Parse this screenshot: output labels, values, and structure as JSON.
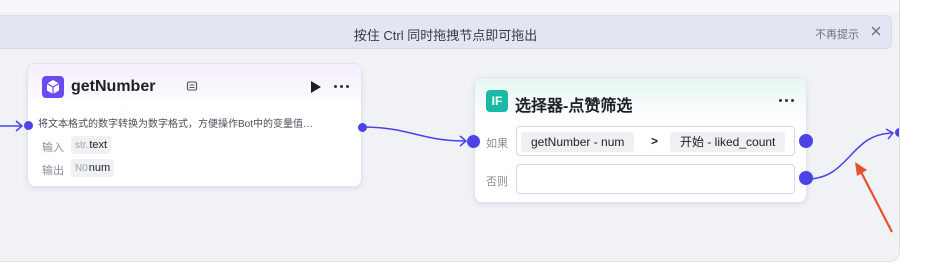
{
  "hint_bar": {
    "text": "按住 Ctrl 同时拖拽节点即可拖出",
    "dismiss_label": "不再提示"
  },
  "node_get_number": {
    "title": "getNumber",
    "description": "将文本格式的数字转换为数字格式，方便操作Bot中的变量值…",
    "input_label": "输入",
    "input_type": "str.",
    "input_name": "text",
    "output_label": "输出",
    "output_type": "N0",
    "output_name": "num"
  },
  "node_selector": {
    "title": "选择器-点赞筛选",
    "icon_text": "IF",
    "if_label": "如果",
    "else_label": "否则",
    "condition": {
      "left_operand": "getNumber  -  num",
      "operator": ">",
      "right_operand": "开始  -  liked_count"
    },
    "else_value": ""
  },
  "colors": {
    "accent": "#4a44e6",
    "arrow": "#e8502a",
    "node_a_icon": "#6b4bf0",
    "node_b_icon": "#1ab9a6"
  }
}
